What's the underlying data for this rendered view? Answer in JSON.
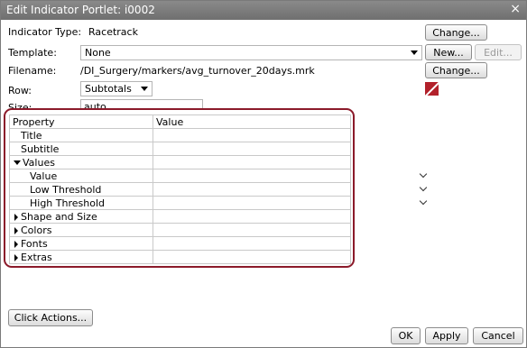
{
  "dialog": {
    "title": "Edit Indicator Portlet: i0002",
    "close_symbol": "×"
  },
  "indicator_type": {
    "label": "Indicator Type:",
    "value": "Racetrack",
    "change_label": "Change..."
  },
  "template": {
    "label": "Template:",
    "value": "None",
    "new_label": "New...",
    "edit_label": "Edit..."
  },
  "filename": {
    "label": "Filename:",
    "value": "/DI_Surgery/markers/avg_turnover_20days.mrk",
    "change_label": "Change..."
  },
  "row": {
    "label": "Row:",
    "value": "Subtotals",
    "color": "#b2212b"
  },
  "size": {
    "label": "Size:",
    "value": "auto"
  },
  "property_grid": {
    "headers": [
      "Property",
      "Value"
    ],
    "rows": [
      {
        "label": "Title",
        "kind": "field"
      },
      {
        "label": "Subtitle",
        "kind": "field"
      },
      {
        "label": "Values",
        "kind": "group-expanded"
      },
      {
        "label": "Value",
        "kind": "dropdown"
      },
      {
        "label": "Low Threshold",
        "kind": "dropdown"
      },
      {
        "label": "High Threshold",
        "kind": "dropdown"
      },
      {
        "label": "Shape and Size",
        "kind": "group-collapsed"
      },
      {
        "label": "Colors",
        "kind": "group-collapsed"
      },
      {
        "label": "Fonts",
        "kind": "group-collapsed"
      },
      {
        "label": "Extras",
        "kind": "group-collapsed"
      }
    ]
  },
  "buttons": {
    "click_actions": "Click Actions...",
    "ok": "OK",
    "apply": "Apply",
    "cancel": "Cancel"
  },
  "colors": {
    "titlebar": "#787878",
    "highlight_border": "#8b1a2a"
  }
}
